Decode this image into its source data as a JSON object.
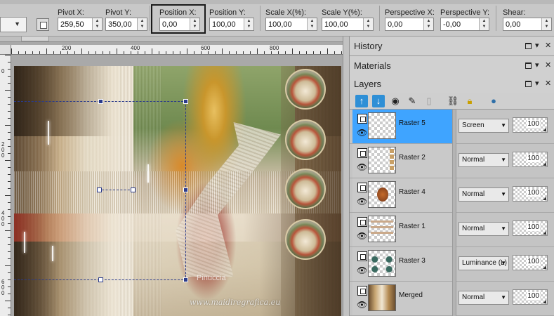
{
  "toolbar": {
    "fields": [
      {
        "label": "Pivot X:",
        "value": "259,50"
      },
      {
        "label": "Pivot Y:",
        "value": "350,00"
      },
      {
        "label": "Position X:",
        "value": "0,00"
      },
      {
        "label": "Position Y:",
        "value": "100,00"
      },
      {
        "label": "Scale X(%):",
        "value": "100,00"
      },
      {
        "label": "Scale Y(%):",
        "value": "100,00"
      },
      {
        "label": "Perspective X:",
        "value": "0,00"
      },
      {
        "label": "Perspective Y:",
        "value": "-0,00"
      },
      {
        "label": "Shear:",
        "value": "0,00"
      }
    ]
  },
  "rulers": {
    "horizontal": [
      "200",
      "400",
      "600",
      "800"
    ],
    "vertical": [
      "0",
      "200",
      "400",
      "600"
    ]
  },
  "canvas": {
    "watermark_name": "Pinuccia",
    "watermark_url": "www.maidiregrafica.eu"
  },
  "palettes": {
    "history": "History",
    "materials": "Materials",
    "layers": "Layers"
  },
  "layers": [
    {
      "name": "Raster 5",
      "blend": "Screen",
      "opacity": "100",
      "selected": true
    },
    {
      "name": "Raster 2",
      "blend": "Normal",
      "opacity": "100",
      "selected": false
    },
    {
      "name": "Raster 4",
      "blend": "Normal",
      "opacity": "100",
      "selected": false
    },
    {
      "name": "Raster 1",
      "blend": "Normal",
      "opacity": "100",
      "selected": false
    },
    {
      "name": "Raster 3",
      "blend": "Luminance (L)",
      "opacity": "100",
      "selected": false
    },
    {
      "name": "Merged",
      "blend": "Normal",
      "opacity": "100",
      "selected": false
    }
  ],
  "colors": {
    "selected_layer": "#3fa4ff",
    "tool_blue": "#2e8fd6",
    "selection_line": "#2a3a8a"
  }
}
